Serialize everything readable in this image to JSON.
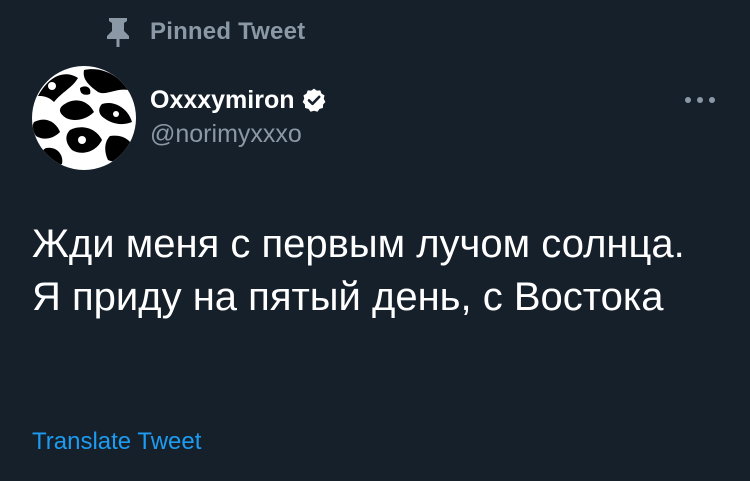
{
  "pinned": {
    "icon": "pin-icon",
    "label": "Pinned Tweet"
  },
  "author": {
    "display_name": "Oxxxymiron",
    "handle": "@norimyxxxo",
    "verified": true,
    "verified_icon": "verified-badge-icon",
    "avatar_icon": "abstract-black-white-pattern-avatar"
  },
  "menu": {
    "icon": "more-options-icon"
  },
  "tweet": {
    "text": "Жди меня с первым лучом солнца. Я приду на пятый день, с Востока"
  },
  "translate": {
    "label": "Translate Tweet"
  },
  "colors": {
    "background": "#15202b",
    "secondary_text": "#8b98a5",
    "link": "#1d9bf0",
    "primary_text": "#ffffff"
  }
}
